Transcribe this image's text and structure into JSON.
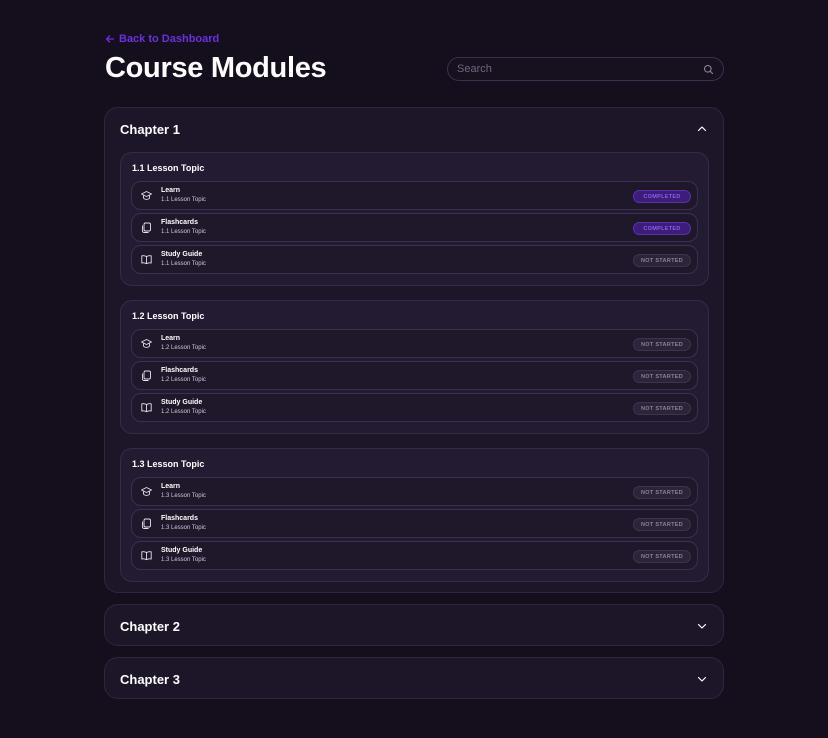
{
  "nav": {
    "back_label": "Back to Dashboard"
  },
  "page": {
    "title": "Course Modules"
  },
  "search": {
    "placeholder": "Search"
  },
  "colors": {
    "accent": "#6a2fe0",
    "background": "#140e1d",
    "completed": "#8d5cf0"
  },
  "chapters": [
    {
      "title": "Chapter 1",
      "expanded": true,
      "lessons": [
        {
          "title": "1.1 Lesson Topic",
          "items": [
            {
              "name": "Learn",
              "sub": "1.1 Lesson Topic",
              "icon": "graduation-cap-icon",
              "status": "COMPLETED"
            },
            {
              "name": "Flashcards",
              "sub": "1.1 Lesson Topic",
              "icon": "flashcards-icon",
              "status": "COMPLETED"
            },
            {
              "name": "Study Guide",
              "sub": "1.1 Lesson Topic",
              "icon": "book-icon",
              "status": "NOT STARTED"
            }
          ]
        },
        {
          "title": "1.2 Lesson Topic",
          "items": [
            {
              "name": "Learn",
              "sub": "1.2 Lesson Topic",
              "icon": "graduation-cap-icon",
              "status": "NOT STARTED"
            },
            {
              "name": "Flashcards",
              "sub": "1.2 Lesson Topic",
              "icon": "flashcards-icon",
              "status": "NOT STARTED"
            },
            {
              "name": "Study Guide",
              "sub": "1.2 Lesson Topic",
              "icon": "book-icon",
              "status": "NOT STARTED"
            }
          ]
        },
        {
          "title": "1.3 Lesson Topic",
          "items": [
            {
              "name": "Learn",
              "sub": "1.3 Lesson Topic",
              "icon": "graduation-cap-icon",
              "status": "NOT STARTED"
            },
            {
              "name": "Flashcards",
              "sub": "1.3 Lesson Topic",
              "icon": "flashcards-icon",
              "status": "NOT STARTED"
            },
            {
              "name": "Study Guide",
              "sub": "1.3 Lesson Topic",
              "icon": "book-icon",
              "status": "NOT STARTED"
            }
          ]
        }
      ]
    },
    {
      "title": "Chapter 2",
      "expanded": false
    },
    {
      "title": "Chapter 3",
      "expanded": false
    }
  ]
}
